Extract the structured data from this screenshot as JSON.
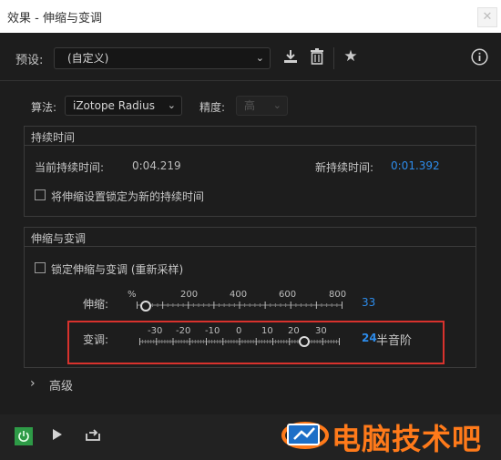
{
  "window": {
    "title": "效果 - 伸缩与变调",
    "close_glyph": "✕"
  },
  "preset": {
    "label": "预设:",
    "value": "(自定义)"
  },
  "toolbar": {
    "save_icon": "download-icon",
    "delete_icon": "trash-icon",
    "favorite_icon": "star-icon",
    "info_icon": "info-icon"
  },
  "algorithm": {
    "label": "算法:",
    "value": "iZotope Radius"
  },
  "precision": {
    "label": "精度:",
    "value": "高",
    "disabled": true
  },
  "duration": {
    "group_title": "持续时间",
    "current_label": "当前持续时间:",
    "current_value": "0:04.219",
    "new_label": "新持续时间:",
    "new_value": "0:01.392",
    "lock_label": "将伸缩设置锁定为新的持续时间",
    "lock_checked": false
  },
  "stretch_pitch": {
    "group_title": "伸缩与变调",
    "lock_label": "锁定伸缩与变调 (重新采样)",
    "lock_checked": false,
    "stretch": {
      "label": "伸缩:",
      "unit": "%",
      "ticks": [
        "200",
        "400",
        "600",
        "800"
      ],
      "value": 33,
      "value_text": "33"
    },
    "pitch": {
      "label": "变调:",
      "ticks": [
        "-30",
        "-20",
        "-10",
        "0",
        "10",
        "20",
        "30"
      ],
      "value": 24,
      "value_text": "24",
      "unit_text": "半音阶"
    }
  },
  "advanced": {
    "label": "高级",
    "chevron": "›"
  },
  "footer": {
    "power_icon": "power-icon",
    "play_icon": "play-icon",
    "loop_icon": "loop-icon"
  },
  "watermark": {
    "text": "电脑技术吧"
  },
  "colors": {
    "accent": "#2d8ceb",
    "highlight": "#d8322d",
    "power": "#2e9b47",
    "watermark": "#ff7a1a"
  }
}
